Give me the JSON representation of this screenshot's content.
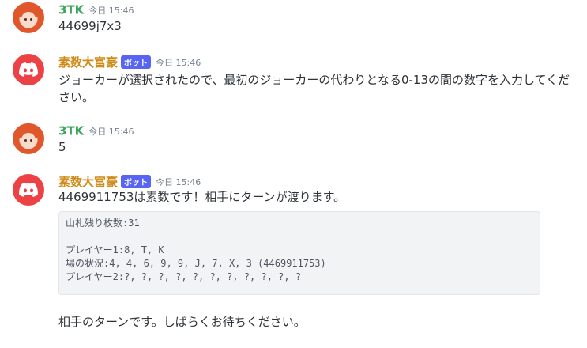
{
  "messages": [
    {
      "author": "3TK",
      "time": "今日 15:46",
      "text": "44699j7x3"
    },
    {
      "author": "素数大富豪",
      "bot_tag": "ボット",
      "time": "今日 15:46",
      "text": "ジョーカーが選択されたので、最初のジョーカーの代わりとなる0-13の間の数字を入力してください。"
    },
    {
      "author": "3TK",
      "time": "今日 15:46",
      "text": "5"
    },
    {
      "author": "素数大富豪",
      "bot_tag": "ボット",
      "time": "今日 15:46",
      "text": "4469911753は素数です！相手にターンが渡ります。",
      "code_lines": [
        "山札残り枚数:31",
        "",
        "プレイヤー1:8, T, K",
        "場の状況:4, 4, 6, 9, 9, J, 7, X, 3 (4469911753)",
        "プレイヤー2:?, ?, ?, ?, ?, ?, ?, ?, ?, ?, ?"
      ],
      "followup": "相手のターンです。しばらくお待ちください。"
    }
  ]
}
